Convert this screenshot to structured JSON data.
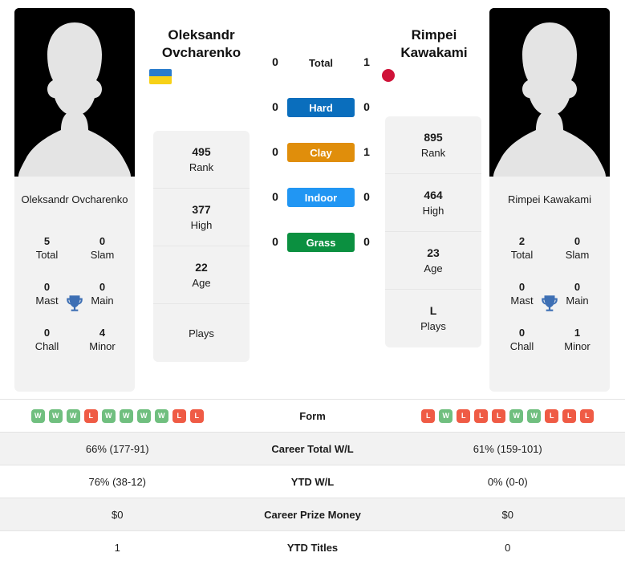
{
  "players": {
    "left": {
      "first_name": "Oleksandr",
      "last_name": "Ovcharenko",
      "full_name": "Oleksandr Ovcharenko",
      "flag": "ukraine-flag",
      "avatar": "player-silhouette",
      "titles": {
        "total": "5",
        "total_label": "Total",
        "slam": "0",
        "slam_label": "Slam",
        "mast": "0",
        "mast_label": "Mast",
        "main": "0",
        "main_label": "Main",
        "chall": "0",
        "chall_label": "Chall",
        "minor": "4",
        "minor_label": "Minor"
      },
      "stats": [
        {
          "value": "495",
          "label": "Rank"
        },
        {
          "value": "377",
          "label": "High"
        },
        {
          "value": "22",
          "label": "Age"
        },
        {
          "value": "",
          "label": "Plays"
        }
      ],
      "form": [
        "W",
        "W",
        "W",
        "L",
        "W",
        "W",
        "W",
        "W",
        "L",
        "L"
      ],
      "career_total_wl": "66% (177-91)",
      "ytd_wl": "76% (38-12)",
      "career_prize_money": "$0",
      "ytd_titles": "1"
    },
    "right": {
      "first_name": "Rimpei",
      "last_name": "Kawakami",
      "full_name": "Rimpei Kawakami",
      "flag": "japan-flag",
      "avatar": "player-silhouette",
      "titles": {
        "total": "2",
        "total_label": "Total",
        "slam": "0",
        "slam_label": "Slam",
        "mast": "0",
        "mast_label": "Mast",
        "main": "0",
        "main_label": "Main",
        "chall": "0",
        "chall_label": "Chall",
        "minor": "1",
        "minor_label": "Minor"
      },
      "stats": [
        {
          "value": "895",
          "label": "Rank"
        },
        {
          "value": "464",
          "label": "High"
        },
        {
          "value": "23",
          "label": "Age"
        },
        {
          "value": "L",
          "label": "Plays"
        }
      ],
      "form": [
        "L",
        "W",
        "L",
        "L",
        "L",
        "W",
        "W",
        "L",
        "L",
        "L"
      ],
      "career_total_wl": "61% (159-101)",
      "ytd_wl": "0% (0-0)",
      "career_prize_money": "$0",
      "ytd_titles": "0"
    }
  },
  "head_to_head": [
    {
      "label": "Total",
      "left": "0",
      "right": "1",
      "color": "",
      "text_color": "#1b1b1b",
      "surface": false
    },
    {
      "label": "Hard",
      "left": "0",
      "right": "0",
      "color": "#0a6ebd",
      "text_color": "#ffffff",
      "surface": true
    },
    {
      "label": "Clay",
      "left": "0",
      "right": "1",
      "color": "#e08e0b",
      "text_color": "#ffffff",
      "surface": true
    },
    {
      "label": "Indoor",
      "left": "0",
      "right": "0",
      "color": "#2196f3",
      "text_color": "#ffffff",
      "surface": true
    },
    {
      "label": "Grass",
      "left": "0",
      "right": "0",
      "color": "#0b9040",
      "text_color": "#ffffff",
      "surface": true
    }
  ],
  "comparison_table": [
    {
      "label": "Form",
      "left": "",
      "right": "",
      "type": "form",
      "alt": false
    },
    {
      "label": "Career Total W/L",
      "left": "66% (177-91)",
      "right": "61% (159-101)",
      "type": "text",
      "alt": true
    },
    {
      "label": "YTD W/L",
      "left": "76% (38-12)",
      "right": "0% (0-0)",
      "type": "text",
      "alt": false
    },
    {
      "label": "Career Prize Money",
      "left": "$0",
      "right": "$0",
      "type": "text",
      "alt": true
    },
    {
      "label": "YTD Titles",
      "left": "1",
      "right": "0",
      "type": "text",
      "alt": false
    }
  ],
  "colors": {
    "hard": "#0a6ebd",
    "clay": "#e08e0b",
    "indoor": "#2196f3",
    "grass": "#0b9040",
    "win_badge": "#70bf7f",
    "loss_badge": "#ef5b45",
    "trophy": "#3d6fb4",
    "panel": "#f2f2f2"
  }
}
